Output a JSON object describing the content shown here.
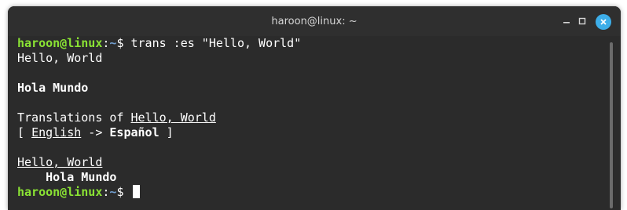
{
  "window": {
    "title": "haroon@linux: ~"
  },
  "terminal": {
    "prompt_user": "haroon@linux",
    "prompt_colon": ":",
    "prompt_path": "~",
    "prompt_symbol": "$ ",
    "command": "trans :es \"Hello, World\"",
    "source_text": "Hello, World",
    "translation": "Hola Mundo",
    "translations_of_prefix": "Translations of ",
    "translations_of_term": "Hello, World",
    "lang_open": "[ ",
    "lang_from": "English",
    "lang_arrow": " -> ",
    "lang_to": "Español",
    "lang_close": " ]",
    "dict_term": "Hello, World",
    "dict_indent": "    ",
    "dict_translation": "Hola Mundo"
  },
  "colors": {
    "prompt_user": "#8ae234",
    "prompt_path": "#729fcf",
    "background": "#2b2b2b",
    "close_button": "#3daee9"
  }
}
